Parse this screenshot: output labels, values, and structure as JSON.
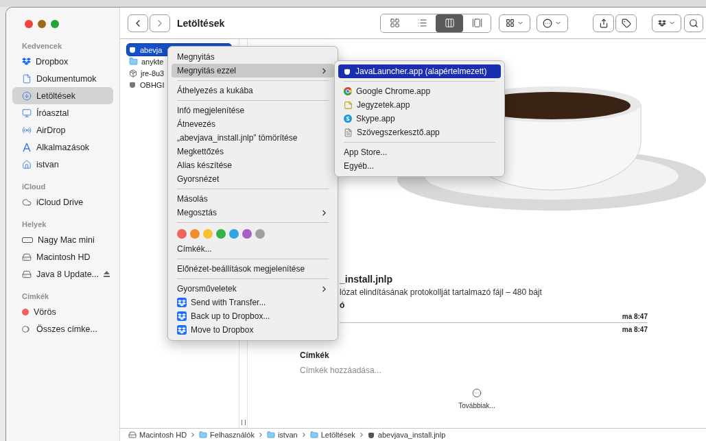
{
  "toolbar": {
    "title": "Letöltések",
    "view_modes": [
      {
        "kind": "icons",
        "selected": false
      },
      {
        "kind": "list",
        "selected": false
      },
      {
        "kind": "columns",
        "selected": true
      },
      {
        "kind": "gallery",
        "selected": false
      }
    ]
  },
  "sidebar": {
    "sections": [
      {
        "title": "Kedvencek",
        "items": [
          {
            "label": "Dropbox",
            "kind": "dropbox",
            "selected": false
          },
          {
            "label": "Dokumentumok",
            "kind": "document",
            "selected": false
          },
          {
            "label": "Letöltések",
            "kind": "download",
            "selected": true
          },
          {
            "label": "Íróasztal",
            "kind": "desktop",
            "selected": false
          },
          {
            "label": "AirDrop",
            "kind": "airdrop",
            "selected": false
          },
          {
            "label": "Alkalmazások",
            "kind": "apps",
            "selected": false
          },
          {
            "label": "istvan",
            "kind": "home",
            "selected": false
          }
        ]
      },
      {
        "title": "iCloud",
        "items": [
          {
            "label": "iCloud Drive",
            "kind": "cloud",
            "selected": false
          }
        ]
      },
      {
        "title": "Helyek",
        "items": [
          {
            "label": "Nagy Mac mini",
            "kind": "display",
            "selected": false,
            "eject": false
          },
          {
            "label": "Macintosh HD",
            "kind": "disk",
            "selected": false,
            "eject": false
          },
          {
            "label": "Java 8 Update...",
            "kind": "disk",
            "selected": false,
            "eject": true
          }
        ]
      },
      {
        "title": "Címkék",
        "items": [
          {
            "label": "Vörös",
            "kind": "tag",
            "selected": false,
            "color": "#f0625c"
          },
          {
            "label": "Összes címke...",
            "kind": "tags",
            "selected": false
          }
        ]
      }
    ]
  },
  "files": [
    {
      "name": "abevja",
      "kind": "java",
      "selected": true
    },
    {
      "name": "anykte",
      "kind": "folder",
      "selected": false
    },
    {
      "name": "jre-8u3",
      "kind": "package",
      "selected": false
    },
    {
      "name": "OBHGI",
      "kind": "java",
      "selected": false
    }
  ],
  "context_menu": {
    "sections": [
      {
        "items": [
          {
            "label": "Megnyitás",
            "kind": "plain",
            "selected": false
          },
          {
            "label": "Megnyitás ezzel",
            "kind": "submenu",
            "selected": true
          }
        ]
      },
      {
        "items": [
          {
            "label": "Áthelyezés a kukába",
            "kind": "plain",
            "selected": false
          }
        ]
      },
      {
        "items": [
          {
            "label": "Infó megjelenítése",
            "kind": "plain",
            "selected": false
          },
          {
            "label": "Átnevezés",
            "kind": "plain",
            "selected": false
          },
          {
            "label": "„abevjava_install.jnlp” tömörítése",
            "kind": "plain",
            "selected": false
          },
          {
            "label": "Megkettőzés",
            "kind": "plain",
            "selected": false
          },
          {
            "label": "Alias készítése",
            "kind": "plain",
            "selected": false
          },
          {
            "label": "Gyorsnézet",
            "kind": "plain",
            "selected": false
          }
        ]
      },
      {
        "items": [
          {
            "label": "Másolás",
            "kind": "plain",
            "selected": false
          },
          {
            "label": "Megosztás",
            "kind": "submenu",
            "selected": false
          }
        ]
      },
      {
        "items": [
          {
            "kind": "colors",
            "colors": [
              {
                "color": "#f0625c"
              },
              {
                "color": "#f08c2e"
              },
              {
                "color": "#f6c230"
              },
              {
                "color": "#35b34a"
              },
              {
                "color": "#2fa3e6"
              },
              {
                "color": "#a65fc4"
              },
              {
                "color": "#a0a0a0"
              }
            ]
          },
          {
            "label": "Címkék...",
            "kind": "plain",
            "selected": false
          }
        ]
      },
      {
        "items": [
          {
            "label": "Előnézet-beállítások megjelenítése",
            "kind": "plain",
            "selected": false
          }
        ]
      },
      {
        "items": [
          {
            "label": "Gyorsműveletek",
            "kind": "submenu",
            "selected": false
          },
          {
            "label": "Send with Transfer...",
            "kind": "dropbox",
            "selected": false
          },
          {
            "label": "Back up to Dropbox...",
            "kind": "dropbox",
            "selected": false
          },
          {
            "label": "Move to Dropbox",
            "kind": "dropbox",
            "selected": false
          }
        ]
      }
    ]
  },
  "open_with_menu": {
    "sections": [
      {
        "items": [
          {
            "label": "JavaLauncher.app (alapértelmezett)",
            "kind": "java",
            "selected": true
          }
        ]
      },
      {
        "items": [
          {
            "label": "Google Chrome.app",
            "kind": "chrome",
            "selected": false
          },
          {
            "label": "Jegyzetek.app",
            "kind": "notes",
            "selected": false
          },
          {
            "label": "Skype.app",
            "kind": "skype",
            "selected": false
          },
          {
            "label": "Szövegszerkesztő.app",
            "kind": "textedit",
            "selected": false
          }
        ]
      },
      {
        "items": [
          {
            "label": "App Store...",
            "kind": "plain",
            "selected": false
          },
          {
            "label": "Egyéb...",
            "kind": "plain",
            "selected": false
          }
        ]
      }
    ]
  },
  "preview": {
    "title": "_install.jnlp",
    "description": "lózat elindításának protokollját tartalmazó fájl – 480 bájt",
    "info_heading": "ó",
    "dates": [
      "ma 8:47",
      "ma 8:47"
    ],
    "tags_heading": "Címkék",
    "tags_placeholder": "Címkék hozzáadása...",
    "more_label": "Továbbiak..."
  },
  "path_bar": [
    {
      "label": "Macintosh HD",
      "kind": "disk"
    },
    {
      "label": "Felhasználók",
      "kind": "folder"
    },
    {
      "label": "istvan",
      "kind": "folder"
    },
    {
      "label": "Letöltések",
      "kind": "folder"
    },
    {
      "label": "abevjava_install.jnlp",
      "kind": "java"
    }
  ]
}
